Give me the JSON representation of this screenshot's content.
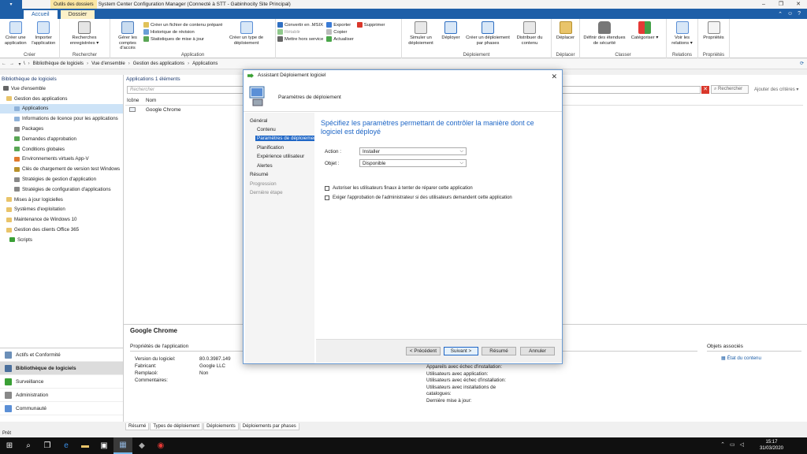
{
  "window": {
    "context_tab": "Outils des dossiers",
    "title": "System Center Configuration Manager (Connecté à STT - Gabinhocity Site Principal)",
    "controls": [
      "–",
      "❐",
      "✕"
    ]
  },
  "ribbon_tabs": {
    "home": "Accueil",
    "folder": "Dossier"
  },
  "ribbon": {
    "create": {
      "label": "Créer",
      "create_app": "Créer une application",
      "import_app": "Importer l'application"
    },
    "search": {
      "label": "Rechercher",
      "saved": "Recherches enregistrées ▾"
    },
    "manage_access": "Gérer les comptes d'accès",
    "prestaged": "Créer un fichier de contenu préparé",
    "revision": "Historique de révision",
    "stats": "Statistiques de mise à jour",
    "application": {
      "label": "Application",
      "create_type": "Créer un type de déploiement"
    },
    "convert": "Convertir en .MSIX",
    "restore": "Rétablir",
    "retire": "Mettre hors service",
    "export": "Exporter",
    "copy": "Copier",
    "refresh": "Actualiser",
    "delete": "Supprimer",
    "deployment": {
      "label": "Déploiement",
      "simulate": "Simuler un déploiement",
      "deploy": "Déployer",
      "phased": "Créer un déploiement par phases",
      "distribute": "Distribuer du contenu"
    },
    "move": {
      "label": "Déplacer",
      "move_btn": "Déplacer"
    },
    "classify": {
      "label": "Classer",
      "scopes": "Définir des étendues de sécurité",
      "categorize": "Catégoriser ▾"
    },
    "relations": {
      "label": "Relations",
      "view": "Voir les relations ▾"
    },
    "properties": {
      "label": "Propriétés",
      "props": "Propriétés"
    }
  },
  "breadcrumb": [
    "\\",
    "Bibliothèque de logiciels",
    "Vue d'ensemble",
    "Gestion des applications",
    "Applications"
  ],
  "leftnav": {
    "header": "Bibliothèque de logiciels",
    "items": [
      "Vue d'ensemble",
      "Gestion des applications",
      "Applications",
      "Informations de licence pour les applications",
      "Packages",
      "Demandes d'approbation",
      "Conditions globales",
      "Environnements virtuels App-V",
      "Clés de chargement de version test Windows",
      "Stratégies de gestion d'application",
      "Stratégies de configuration d'applications",
      "Mises à jour logicielles",
      "Systèmes d'exploitation",
      "Maintenance de Windows 10",
      "Gestion des clients Office 365",
      "Scripts"
    ]
  },
  "wunderbar": [
    "Actifs et Conformité",
    "Bibliothèque de logiciels",
    "Surveillance",
    "Administration",
    "Communauté"
  ],
  "main": {
    "header": "Applications 1 éléments",
    "search_placeholder": "Rechercher",
    "search_button": "Rechercher",
    "advanced": "Ajouter des critères ▾",
    "columns": [
      "Icône",
      "Nom"
    ],
    "rows": [
      {
        "name": "Google Chrome"
      }
    ]
  },
  "details": {
    "title": "Google Chrome",
    "section": "Propriétés de l'application",
    "rows": [
      {
        "k": "Version du logiciel:",
        "v": "80.0.3987.149"
      },
      {
        "k": "Fabricant:",
        "v": "Google LLC"
      },
      {
        "k": "Remplacé:",
        "v": "Non"
      },
      {
        "k": "Commentaires:",
        "v": ""
      }
    ],
    "right_text": [
      "Appareils avec échec d'installation:",
      "Utilisateurs avec application:",
      "Utilisateurs avec échec d'installation:",
      "Utilisateurs avec installations de catalogues:",
      "Dernière mise à jour:"
    ],
    "assoc_title": "Objets associés",
    "assoc_link": "État du contenu",
    "tabs": [
      "Résumé",
      "Types de déploiement",
      "Déploiements",
      "Déploiements par phases"
    ]
  },
  "status": "Prêt",
  "taskbar": {
    "time": "15:17",
    "date": "31/03/2020"
  },
  "wizard": {
    "title": "Assistant Déploiement logiciel",
    "header": "Paramètres de déploiement",
    "steps": [
      "Général",
      "Contenu",
      "Paramètres de déploiement",
      "Planification",
      "Expérience utilisateur",
      "Alertes",
      "Résumé",
      "Progression",
      "Dernière étape"
    ],
    "heading": "Spécifiez les paramètres permettant de contrôler la manière dont ce logiciel est déployé",
    "action_label": "Action :",
    "action_value": "Installer",
    "purpose_label": "Objet :",
    "purpose_value": "Disponible",
    "chk_repair": "Autoriser les utilisateurs finaux à tenter de réparer cette application",
    "chk_approval": "Exiger l'approbation de l'administrateur si des utilisateurs demandent cette application",
    "btn_prev": "< Précédent",
    "btn_next": "Suivant >",
    "btn_summary": "Résumé",
    "btn_cancel": "Annuler"
  }
}
